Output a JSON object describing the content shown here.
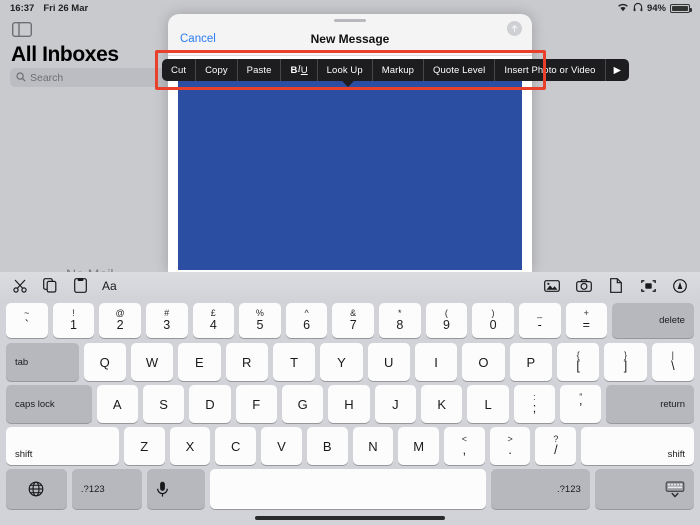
{
  "statusbar": {
    "time": "16:37",
    "date": "Fri 26 Mar",
    "battery_percent": "94%",
    "wifi_icon": "wifi-icon",
    "headphones_icon": "headphones-icon",
    "battery_icon": "battery-icon"
  },
  "mail_app": {
    "sidebar_toggle_icon": "sidebar-toggle-icon",
    "title": "All Inboxes",
    "search_placeholder": "Search",
    "search_icon": "search-icon",
    "empty_state": "No Mail"
  },
  "compose_sheet": {
    "cancel_label": "Cancel",
    "title": "New Message",
    "send_icon": "send-arrow-up-icon",
    "grabber": "sheet-grabber"
  },
  "edit_menu": {
    "items": [
      {
        "label": "Cut",
        "name": "menu-item-cut"
      },
      {
        "label": "Copy",
        "name": "menu-item-copy"
      },
      {
        "label": "Paste",
        "name": "menu-item-paste"
      },
      {
        "label": "BIU",
        "name": "menu-item-biu"
      },
      {
        "label": "Look Up",
        "name": "menu-item-look-up"
      },
      {
        "label": "Markup",
        "name": "menu-item-markup"
      },
      {
        "label": "Quote Level",
        "name": "menu-item-quote-level"
      },
      {
        "label": "Insert Photo or Video",
        "name": "menu-item-insert-photo-or-video"
      },
      {
        "label": "▶",
        "name": "menu-item-next-page"
      }
    ],
    "biu": {
      "bold": "B",
      "italic": "I",
      "underline": "U"
    },
    "highlight_color": "#e8402a"
  },
  "attachment": {
    "color": "#2b4ea2",
    "name": "selected-image-attachment"
  },
  "keyboard_accessory": {
    "left_icons": [
      {
        "name": "cut-scissors-icon",
        "label": "✂"
      },
      {
        "name": "copy-icon",
        "label": "copy"
      },
      {
        "name": "paste-icon",
        "label": "paste"
      },
      {
        "name": "format-text-icon",
        "label": "Aa"
      }
    ],
    "right_icons": [
      {
        "name": "photo-library-icon"
      },
      {
        "name": "camera-icon"
      },
      {
        "name": "document-icon"
      },
      {
        "name": "scan-document-icon"
      },
      {
        "name": "markup-pen-icon"
      }
    ]
  },
  "keyboard": {
    "rows": [
      {
        "name": "keyboard-row-numbers",
        "keys": [
          {
            "name": "key-backtick",
            "up": "~",
            "lo": "`",
            "flex": 1
          },
          {
            "name": "key-1",
            "up": "!",
            "lo": "1",
            "flex": 1
          },
          {
            "name": "key-2",
            "up": "@",
            "lo": "2",
            "flex": 1
          },
          {
            "name": "key-3",
            "up": "#",
            "lo": "3",
            "flex": 1
          },
          {
            "name": "key-4",
            "up": "£",
            "lo": "4",
            "flex": 1
          },
          {
            "name": "key-5",
            "up": "%",
            "lo": "5",
            "flex": 1
          },
          {
            "name": "key-6",
            "up": "^",
            "lo": "6",
            "flex": 1
          },
          {
            "name": "key-7",
            "up": "&",
            "lo": "7",
            "flex": 1
          },
          {
            "name": "key-8",
            "up": "*",
            "lo": "8",
            "flex": 1
          },
          {
            "name": "key-9",
            "up": "(",
            "lo": "9",
            "flex": 1
          },
          {
            "name": "key-0",
            "up": ")",
            "lo": "0",
            "flex": 1
          },
          {
            "name": "key-hyphen",
            "up": "_",
            "lo": "-",
            "flex": 1
          },
          {
            "name": "key-equals",
            "up": "+",
            "lo": "=",
            "flex": 1
          },
          {
            "name": "key-delete",
            "label": "delete",
            "dark": true,
            "flex": 1.75,
            "align": "right",
            "small": true
          }
        ]
      },
      {
        "name": "keyboard-row-qwerty",
        "keys": [
          {
            "name": "key-tab",
            "label": "tab",
            "dark": true,
            "flex": 1.5,
            "align": "left",
            "small": true
          },
          {
            "name": "key-q",
            "label": "Q",
            "flex": 1
          },
          {
            "name": "key-w",
            "label": "W",
            "flex": 1
          },
          {
            "name": "key-e",
            "label": "E",
            "flex": 1
          },
          {
            "name": "key-r",
            "label": "R",
            "flex": 1
          },
          {
            "name": "key-t",
            "label": "T",
            "flex": 1
          },
          {
            "name": "key-y",
            "label": "Y",
            "flex": 1
          },
          {
            "name": "key-u",
            "label": "U",
            "flex": 1
          },
          {
            "name": "key-i",
            "label": "I",
            "flex": 1
          },
          {
            "name": "key-o",
            "label": "O",
            "flex": 1
          },
          {
            "name": "key-p",
            "label": "P",
            "flex": 1
          },
          {
            "name": "key-bracket-left",
            "up": "{",
            "lo": "[",
            "flex": 1
          },
          {
            "name": "key-bracket-right",
            "up": "}",
            "lo": "]",
            "flex": 1
          },
          {
            "name": "key-backslash",
            "up": "|",
            "lo": "\\",
            "flex": 1
          }
        ]
      },
      {
        "name": "keyboard-row-home",
        "keys": [
          {
            "name": "key-caps-lock",
            "label": "caps lock",
            "dark": true,
            "flex": 1.85,
            "align": "left",
            "small": true
          },
          {
            "name": "key-a",
            "label": "A",
            "flex": 1
          },
          {
            "name": "key-s",
            "label": "S",
            "flex": 1
          },
          {
            "name": "key-d",
            "label": "D",
            "flex": 1
          },
          {
            "name": "key-f",
            "label": "F",
            "flex": 1
          },
          {
            "name": "key-g",
            "label": "G",
            "flex": 1
          },
          {
            "name": "key-h",
            "label": "H",
            "flex": 1
          },
          {
            "name": "key-j",
            "label": "J",
            "flex": 1
          },
          {
            "name": "key-k",
            "label": "K",
            "flex": 1
          },
          {
            "name": "key-l",
            "label": "L",
            "flex": 1
          },
          {
            "name": "key-semicolon",
            "up": ":",
            "lo": ";",
            "flex": 1
          },
          {
            "name": "key-quote",
            "up": "”",
            "lo": "’",
            "flex": 1
          },
          {
            "name": "key-return",
            "label": "return",
            "dark": true,
            "flex": 1.9,
            "align": "right",
            "small": true
          }
        ]
      },
      {
        "name": "keyboard-row-shift",
        "keys": [
          {
            "name": "key-shift-left",
            "label": "shift",
            "flex": 2.55,
            "align": "bottom-left",
            "small": true
          },
          {
            "name": "key-z",
            "label": "Z",
            "flex": 1
          },
          {
            "name": "key-x",
            "label": "X",
            "flex": 1
          },
          {
            "name": "key-c",
            "label": "C",
            "flex": 1
          },
          {
            "name": "key-v",
            "label": "V",
            "flex": 1
          },
          {
            "name": "key-b",
            "label": "B",
            "flex": 1
          },
          {
            "name": "key-n",
            "label": "N",
            "flex": 1
          },
          {
            "name": "key-m",
            "label": "M",
            "flex": 1
          },
          {
            "name": "key-comma",
            "up": "<",
            "lo": ",",
            "flex": 1
          },
          {
            "name": "key-period",
            "up": ">",
            "lo": ".",
            "flex": 1
          },
          {
            "name": "key-slash",
            "up": "?",
            "lo": "/",
            "flex": 1
          },
          {
            "name": "key-shift-right",
            "label": "shift",
            "flex": 2.55,
            "align": "bottom-right",
            "small": true
          }
        ]
      },
      {
        "name": "keyboard-row-bottom",
        "keys": [
          {
            "name": "key-globe",
            "icon": "globe-icon",
            "dark": true,
            "flex": 1.35
          },
          {
            "name": "key-numeric-left",
            "label": ".?123",
            "dark": true,
            "flex": 1.35,
            "align": "left",
            "small": true
          },
          {
            "name": "key-dictation",
            "icon": "microphone-icon",
            "dark": true,
            "flex": 1.1,
            "align": "left"
          },
          {
            "name": "key-space",
            "label": "",
            "flex": 6.1
          },
          {
            "name": "key-numeric-right",
            "label": ".?123",
            "dark": true,
            "flex": 2.0,
            "align": "right",
            "small": true
          },
          {
            "name": "key-dismiss-keyboard",
            "icon": "hide-keyboard-icon",
            "dark": true,
            "flex": 2.0,
            "align": "right"
          }
        ]
      }
    ]
  }
}
